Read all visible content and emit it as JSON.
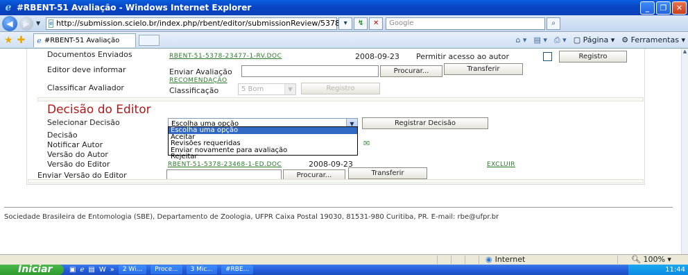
{
  "window": {
    "title": "#RBENT-51 Avaliação - Windows Internet Explorer"
  },
  "browser": {
    "url": "http://submission.scielo.br/index.php/rbent/editor/submissionReview/5378",
    "search_placeholder": "Google",
    "tab_label": "#RBENT-51 Avaliação",
    "command_page": "Página",
    "command_tools": "Ferramentas"
  },
  "review": {
    "docs_label": "Documentos Enviados",
    "docs_file": "RBENT-51-5378-23477-1-RV.DOC",
    "docs_date": "2008-09-23",
    "allow_access_label": "Permitir acesso ao autor",
    "register_button": "Registro",
    "editor_inform_label": "Editor deve informar",
    "send_eval_label": "Enviar Avaliação",
    "browse_button": "Procurar...",
    "transfer_button": "Transferir",
    "recommendation_link": "RECOMENDAÇÃO",
    "classify_reviewer_label": "Classificar Avaliador",
    "classification_label": "Classificação",
    "classification_value": "5 Bom",
    "classification_register_button": "Registro"
  },
  "decision": {
    "title": "Decisão do Editor",
    "select_label": "Selecionar Decisão",
    "select_value": "Escolha uma opção",
    "register_decision_button": "Registrar Decisão",
    "options": [
      "Escolha uma opção",
      "Aceitar",
      "Revisões requeridas",
      "Enviar novamente para avaliação",
      "Rejeitar"
    ],
    "decision_label": "Decisão",
    "notify_author_label": "Notificar Autor",
    "author_version_label": "Versão do Autor",
    "editor_version_label": "Versão do Editor",
    "editor_version_file": "RBENT-51-5378-23468-1-ED.DOC",
    "editor_version_date": "2008-09-23",
    "delete_link": "EXCLUIR",
    "send_editor_version_label": "Enviar Versão do Editor",
    "browse_button": "Procurar...",
    "transfer_button": "Transferir"
  },
  "footer": {
    "text": "Sociedade Brasileira de Entomologia (SBE), Departamento de Zoologia, UFPR Caixa Postal 19030, 81531-980 Curitiba, PR. E-mail: rbe@ufpr.br"
  },
  "statusbar": {
    "zone": "Internet",
    "zoom": "100%"
  },
  "taskbar": {
    "start": "Iniciar",
    "tasks": [
      "2 Wi...",
      "Proce...",
      "3 Mic...",
      "#RBE..."
    ],
    "clock": "11:44"
  }
}
